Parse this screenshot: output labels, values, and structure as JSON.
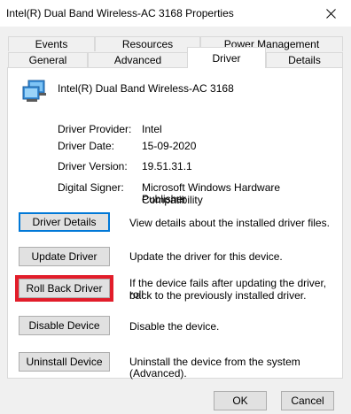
{
  "window": {
    "title": "Intel(R) Dual Band Wireless-AC 3168 Properties"
  },
  "tabs": {
    "row1": [
      {
        "label": "Events"
      },
      {
        "label": "Resources"
      },
      {
        "label": "Power Management"
      }
    ],
    "row2": [
      {
        "label": "General"
      },
      {
        "label": "Advanced"
      },
      {
        "label": "Driver",
        "active": true
      },
      {
        "label": "Details"
      }
    ]
  },
  "device": {
    "icon": "network-adapter-icon",
    "name": "Intel(R) Dual Band Wireless-AC 3168"
  },
  "properties": [
    {
      "label": "Driver Provider:",
      "value": "Intel"
    },
    {
      "label": "Driver Date:",
      "value": "15-09-2020"
    },
    {
      "label": "Driver Version:",
      "value": "19.51.31.1"
    },
    {
      "label": "Digital Signer:",
      "value_line1": "Microsoft Windows Hardware Compatibility",
      "value_line2": "Publisher"
    }
  ],
  "actions": [
    {
      "button": "Driver Details",
      "description": "View details about the installed driver files."
    },
    {
      "button": "Update Driver",
      "description": "Update the driver for this device."
    },
    {
      "button": "Roll Back Driver",
      "description_line1": "If the device fails after updating the driver, roll",
      "description_line2": "back to the previously installed driver."
    },
    {
      "button": "Disable Device",
      "description": "Disable the device."
    },
    {
      "button": "Uninstall Device",
      "description": "Uninstall the device from the system (Advanced)."
    }
  ],
  "footer": {
    "ok_label": "OK",
    "cancel_label": "Cancel"
  },
  "colors": {
    "highlight_border": "#e21d2a",
    "default_button_border": "#0078d7"
  }
}
